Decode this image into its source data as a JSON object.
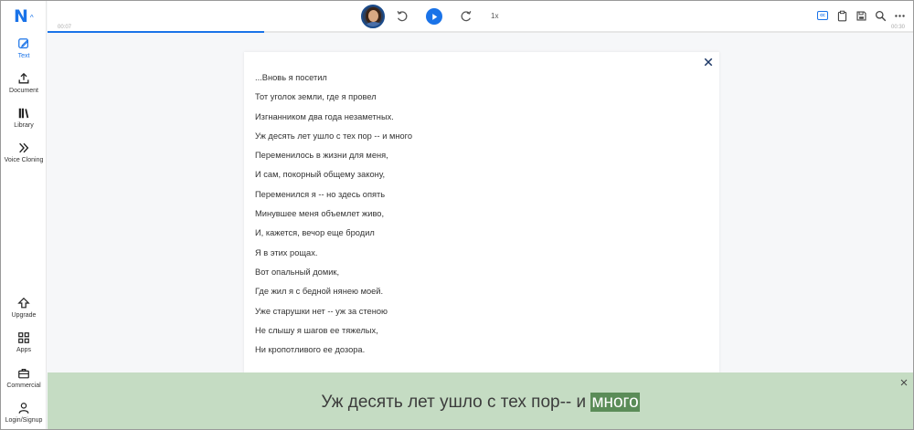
{
  "app": {
    "logo_letter": "N"
  },
  "sidebar": {
    "top_items": [
      {
        "label": "Text",
        "icon": "pencil-icon",
        "active": true
      },
      {
        "label": "Document",
        "icon": "upload-icon",
        "active": false
      },
      {
        "label": "Library",
        "icon": "books-icon",
        "active": false
      },
      {
        "label": "Voice Cloning",
        "icon": "chevrons-right-icon",
        "active": false
      }
    ],
    "bottom_items": [
      {
        "label": "Upgrade",
        "icon": "upgrade-arrow-icon"
      },
      {
        "label": "Apps",
        "icon": "apps-grid-icon"
      },
      {
        "label": "Commercial",
        "icon": "briefcase-icon"
      },
      {
        "label": "Login/Signup",
        "icon": "user-icon"
      }
    ]
  },
  "player": {
    "speed": "1x",
    "time_current": "00:07",
    "time_total": "00:30",
    "progress_fraction": 0.25,
    "accent_color": "#1a73e8"
  },
  "toolbar_right": {
    "cc_label": "cc",
    "icons": [
      "closed-captions-icon",
      "clipboard-icon",
      "save-icon",
      "search-icon",
      "more-icon"
    ]
  },
  "document": {
    "lines": [
      "...Вновь я посетил",
      "Тот уголок земли, где я провел",
      "Изгнанником два года незаметных.",
      "Уж десять лет ушло с тех пор -- и много",
      "Переменилось в жизни для меня,",
      "И сам, покорный общему закону,",
      "Переменился я -- но здесь опять",
      "Минувшее меня объемлет живо,",
      "И, кажется, вечор еще бродил",
      "Я в этих рощах.",
      "Вот опальный домик,",
      "Где жил я с бедной нянею моей.",
      "Уже старушки нет -- уж за стеною",
      "Не слышу я шагов ее тяжелых,",
      "Ни кропотливого ее дозора."
    ]
  },
  "caption": {
    "text_before": "Уж десять лет ушло с тех пор-- и ",
    "highlighted_word": "много",
    "background_color": "#c5dcc3",
    "highlight_color": "#5b8c58"
  }
}
